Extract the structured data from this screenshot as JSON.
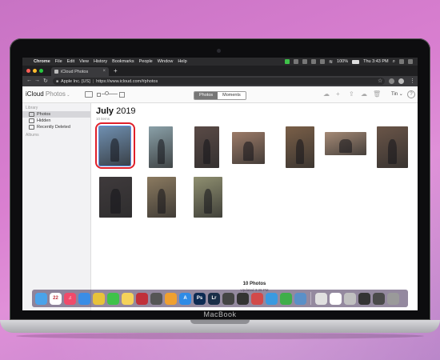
{
  "device": {
    "brand": "MacBook"
  },
  "menubar": {
    "app": "Chrome",
    "items": [
      "File",
      "Edit",
      "View",
      "History",
      "Bookmarks",
      "People",
      "Window",
      "Help"
    ],
    "battery": "100%",
    "clock": "Thu 3:43 PM"
  },
  "browser": {
    "tab_title": "iCloud Photos",
    "address_org": "Apple Inc. [US]",
    "address_url": "https://www.icloud.com/#photos"
  },
  "app": {
    "logo_main": "iCloud",
    "logo_sub": "Photos",
    "segments": [
      "Photos",
      "Moments"
    ],
    "user_menu": "Tin",
    "help": "?"
  },
  "sidebar": {
    "section_library": "Library",
    "items": [
      "Photos",
      "Hidden",
      "Recently Deleted"
    ],
    "section_albums": "Albums"
  },
  "main": {
    "month": "July",
    "year": "2019",
    "count_label": "10 items",
    "footer_count": "10 Photos",
    "footer_updated": "Updated 3:39 PM"
  },
  "photos": [
    {
      "label": "photo-1",
      "color": "#6f8fb0"
    },
    {
      "label": "photo-2",
      "color": "#8aa0a8"
    },
    {
      "label": "photo-3",
      "color": "#5a4a46"
    },
    {
      "label": "photo-4",
      "color": "#9c7b68"
    },
    {
      "label": "photo-5",
      "color": "#7a5f48"
    },
    {
      "label": "photo-6",
      "color": "#a58a76"
    },
    {
      "label": "photo-7",
      "color": "#6a5548"
    },
    {
      "label": "photo-8",
      "color": "#3f3a3c"
    },
    {
      "label": "photo-9",
      "color": "#8b7a60"
    },
    {
      "label": "photo-10",
      "color": "#8f8f70"
    }
  ],
  "dock": {
    "icons": [
      {
        "name": "finder",
        "color": "#4aa3ea",
        "text": ""
      },
      {
        "name": "calendar",
        "color": "#ffffff",
        "text": "22"
      },
      {
        "name": "music",
        "color": "#f04a6a",
        "text": "♫"
      },
      {
        "name": "safari",
        "color": "#3a8de6",
        "text": ""
      },
      {
        "name": "chrome",
        "color": "#e8c23a",
        "text": ""
      },
      {
        "name": "messages",
        "color": "#3fc24a",
        "text": ""
      },
      {
        "name": "notes",
        "color": "#f5d25a",
        "text": ""
      },
      {
        "name": "photo-booth",
        "color": "#c0303a",
        "text": ""
      },
      {
        "name": "app-9",
        "color": "#555555",
        "text": ""
      },
      {
        "name": "photos",
        "color": "#f0a030",
        "text": ""
      },
      {
        "name": "app-store",
        "color": "#2f8be6",
        "text": "A"
      },
      {
        "name": "photoshop",
        "color": "#0d2a52",
        "text": "Ps"
      },
      {
        "name": "lightroom",
        "color": "#1a2e48",
        "text": "Lr"
      },
      {
        "name": "app-14",
        "color": "#444444",
        "text": ""
      },
      {
        "name": "activity",
        "color": "#333333",
        "text": ""
      },
      {
        "name": "app-16",
        "color": "#d24a4a",
        "text": ""
      },
      {
        "name": "app-17",
        "color": "#3a9ae0",
        "text": ""
      },
      {
        "name": "evernote",
        "color": "#3fae4a",
        "text": ""
      },
      {
        "name": "preview",
        "color": "#5a90c8",
        "text": ""
      },
      {
        "name": "app-20",
        "color": "#e0e0e0",
        "text": ""
      },
      {
        "name": "app-21",
        "color": "#ffffff",
        "text": ""
      },
      {
        "name": "app-22",
        "color": "#c0c0c0",
        "text": ""
      },
      {
        "name": "app-23",
        "color": "#333333",
        "text": ""
      },
      {
        "name": "app-24",
        "color": "#4a4a4a",
        "text": ""
      },
      {
        "name": "trash",
        "color": "#9a9a9a",
        "text": ""
      }
    ]
  },
  "colors": {
    "selection_ring": "#e0202a",
    "menubar_bg": "#2b2b2d"
  }
}
